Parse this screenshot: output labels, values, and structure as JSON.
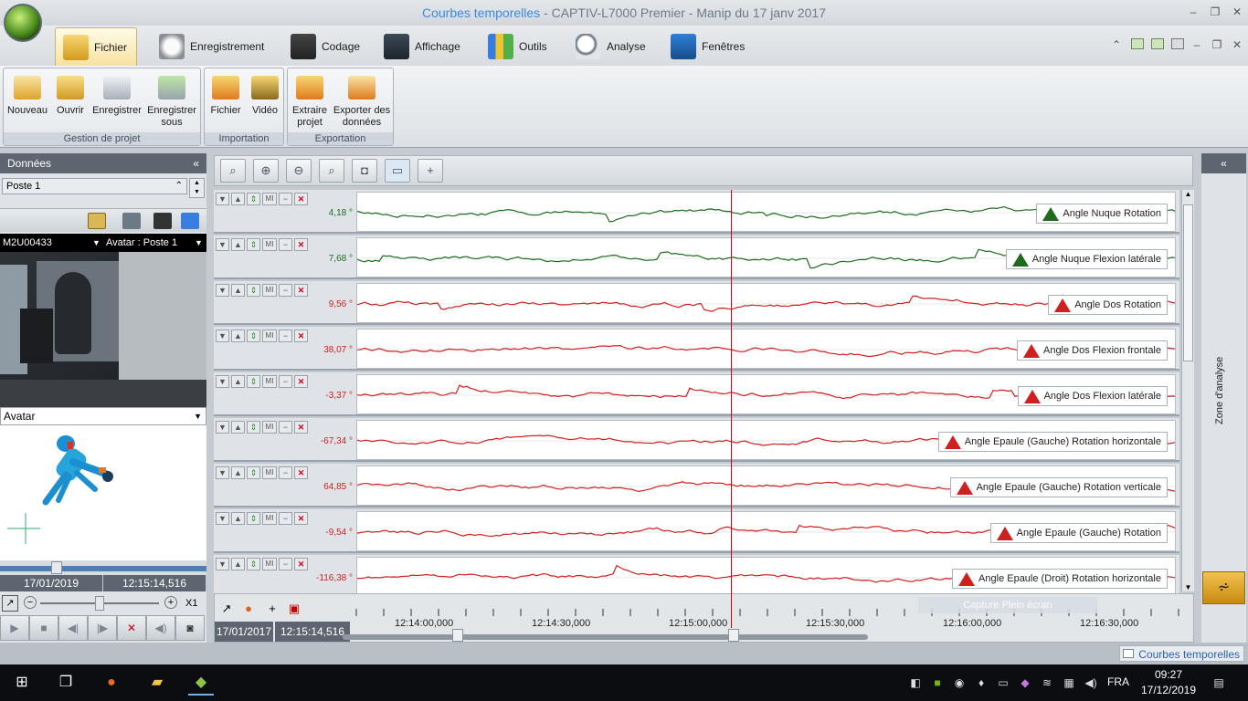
{
  "window": {
    "title_prefix": "Courbes temporelles",
    "title_suffix": " - CAPTIV-L7000 Premier - Manip du 17 janv 2017"
  },
  "tabs": [
    {
      "label": "Fichier",
      "icon": "folder-icon",
      "active": true
    },
    {
      "label": "Enregistrement",
      "icon": "stopwatch-icon"
    },
    {
      "label": "Codage",
      "icon": "clapper-icon"
    },
    {
      "label": "Affichage",
      "icon": "monitor-chart-icon"
    },
    {
      "label": "Outils",
      "icon": "bar-chart-icon"
    },
    {
      "label": "Analyse",
      "icon": "magnifier-icon"
    },
    {
      "label": "Fenêtres",
      "icon": "window-icon"
    }
  ],
  "ribbon": {
    "groups": [
      {
        "caption": "Gestion de projet",
        "buttons": [
          "Nouveau",
          "Ouvrir",
          "Enregistrer",
          "Enregistrer sous"
        ]
      },
      {
        "caption": "Importation",
        "buttons": [
          "Fichier",
          "Vidéo"
        ]
      },
      {
        "caption": "Exportation",
        "buttons": [
          "Extraire projet",
          "Exporter des données"
        ]
      }
    ]
  },
  "left_panel": {
    "header": "Données",
    "collapse": "«",
    "poste": "Poste 1",
    "sensor": "M2U00433",
    "avatar_source": "Avatar : Poste 1",
    "view_select": "Avatar",
    "date": "17/01/2019",
    "time": "12:15:14,516",
    "speed": "X1"
  },
  "graph": {
    "rows": [
      {
        "value": "4,18 °",
        "label": "Angle Nuque Rotation",
        "color": "#1e6b1e"
      },
      {
        "value": "7,68 °",
        "label": "Angle Nuque Flexion latérale",
        "color": "#1e6b1e"
      },
      {
        "value": "9,56 °",
        "label": "Angle Dos Rotation",
        "color": "#d11f1f"
      },
      {
        "value": "38,07 °",
        "label": "Angle Dos Flexion frontale",
        "color": "#d11f1f"
      },
      {
        "value": "-3,37 °",
        "label": "Angle Dos Flexion latérale",
        "color": "#d11f1f"
      },
      {
        "value": "-67,34 °",
        "label": "Angle Epaule (Gauche) Rotation horizontale",
        "color": "#d11f1f"
      },
      {
        "value": "64,85 °",
        "label": "Angle Epaule (Gauche) Rotation verticale",
        "color": "#d11f1f"
      },
      {
        "value": "-9,54 °",
        "label": "Angle Epaule (Gauche) Rotation",
        "color": "#d11f1f"
      },
      {
        "value": "-116,38 °",
        "label": "Angle Epaule (Droit) Rotation horizontale",
        "color": "#d11f1f"
      }
    ],
    "row_controls": {
      "move_down": "▼",
      "move_up": "▲",
      "scale": "⇕",
      "multi": "MI",
      "minimize": "−",
      "close": "✕"
    },
    "timebar": {
      "date": "17/01/2017",
      "time": "12:15:14,516",
      "ticks": [
        "12:14:00,000",
        "12:14:30,000",
        "12:15:00,000",
        "12:15:30,000",
        "12:16:00,000",
        "12:16:30,000"
      ],
      "hint": "Capture Plein écran"
    }
  },
  "right_panel": {
    "collapse": "«",
    "label": "Zone d'analyse"
  },
  "status": {
    "item": "Courbes temporelles"
  },
  "taskbar": {
    "lang": "FRA",
    "time": "09:27",
    "date": "17/12/2019"
  }
}
